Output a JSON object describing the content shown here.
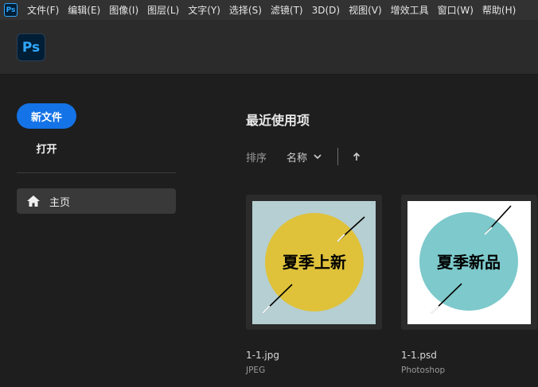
{
  "menubar": {
    "logo": "Ps",
    "items": [
      "文件(F)",
      "编辑(E)",
      "图像(I)",
      "图层(L)",
      "文字(Y)",
      "选择(S)",
      "滤镜(T)",
      "3D(D)",
      "视图(V)",
      "增效工具",
      "窗口(W)",
      "帮助(H)"
    ]
  },
  "header": {
    "logo": "Ps"
  },
  "sidebar": {
    "new_file": "新文件",
    "open": "打开",
    "home": "主页"
  },
  "main": {
    "title": "最近使用项",
    "sort_label": "排序",
    "sort_value": "名称"
  },
  "files": [
    {
      "name": "1-1.jpg",
      "type": "JPEG",
      "thumb_text": "夏季上新",
      "bg": "#b5cfd2",
      "circle": "#dfc23a"
    },
    {
      "name": "1-1.psd",
      "type": "Photoshop",
      "thumb_text": "夏季新品",
      "bg": "#ffffff",
      "circle": "#7dc9cb"
    }
  ],
  "colors": {
    "accent": "#1473e6",
    "ps_blue": "#31a8ff"
  }
}
